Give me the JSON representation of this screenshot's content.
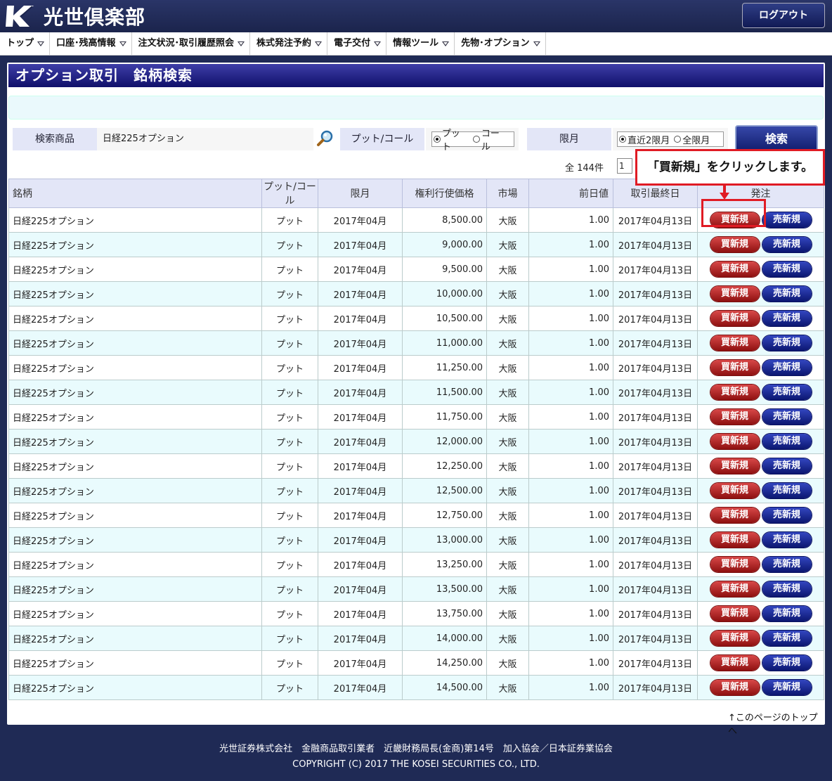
{
  "header": {
    "logo_text": "光世倶楽部",
    "logout_label": "ログアウト"
  },
  "nav": [
    {
      "label": "トップ"
    },
    {
      "label": "口座･残高情報"
    },
    {
      "label": "注文状況･取引履歴照会"
    },
    {
      "label": "株式発注予約"
    },
    {
      "label": "電子交付"
    },
    {
      "label": "情報ツール"
    },
    {
      "label": "先物･オプション"
    }
  ],
  "page_title": "オプション取引　銘柄検索",
  "search": {
    "product_label": "検索商品",
    "product_value": "日経225オプション",
    "putcall_label": "プット/コール",
    "put_option": "プット",
    "call_option": "コール",
    "putcall_selected": "プット",
    "expiry_label": "限月",
    "expiry_recent": "直近2限月",
    "expiry_all": "全限月",
    "expiry_selected": "直近2限月",
    "search_button": "検索"
  },
  "results": {
    "count_text": "全 144件",
    "page": "1"
  },
  "table": {
    "headers": [
      "銘柄",
      "プット/コール",
      "限月",
      "権利行使価格",
      "市場",
      "前日値",
      "取引最終日",
      "発注"
    ],
    "buy_label": "買新規",
    "sell_label": "売新規",
    "rows": [
      {
        "name": "日経225オプション",
        "type": "プット",
        "month": "2017年04月",
        "strike": "8,500.00",
        "market": "大阪",
        "prev": "1.00",
        "last": "2017年04月13日"
      },
      {
        "name": "日経225オプション",
        "type": "プット",
        "month": "2017年04月",
        "strike": "9,000.00",
        "market": "大阪",
        "prev": "1.00",
        "last": "2017年04月13日"
      },
      {
        "name": "日経225オプション",
        "type": "プット",
        "month": "2017年04月",
        "strike": "9,500.00",
        "market": "大阪",
        "prev": "1.00",
        "last": "2017年04月13日"
      },
      {
        "name": "日経225オプション",
        "type": "プット",
        "month": "2017年04月",
        "strike": "10,000.00",
        "market": "大阪",
        "prev": "1.00",
        "last": "2017年04月13日"
      },
      {
        "name": "日経225オプション",
        "type": "プット",
        "month": "2017年04月",
        "strike": "10,500.00",
        "market": "大阪",
        "prev": "1.00",
        "last": "2017年04月13日"
      },
      {
        "name": "日経225オプション",
        "type": "プット",
        "month": "2017年04月",
        "strike": "11,000.00",
        "market": "大阪",
        "prev": "1.00",
        "last": "2017年04月13日"
      },
      {
        "name": "日経225オプション",
        "type": "プット",
        "month": "2017年04月",
        "strike": "11,250.00",
        "market": "大阪",
        "prev": "1.00",
        "last": "2017年04月13日"
      },
      {
        "name": "日経225オプション",
        "type": "プット",
        "month": "2017年04月",
        "strike": "11,500.00",
        "market": "大阪",
        "prev": "1.00",
        "last": "2017年04月13日"
      },
      {
        "name": "日経225オプション",
        "type": "プット",
        "month": "2017年04月",
        "strike": "11,750.00",
        "market": "大阪",
        "prev": "1.00",
        "last": "2017年04月13日"
      },
      {
        "name": "日経225オプション",
        "type": "プット",
        "month": "2017年04月",
        "strike": "12,000.00",
        "market": "大阪",
        "prev": "1.00",
        "last": "2017年04月13日"
      },
      {
        "name": "日経225オプション",
        "type": "プット",
        "month": "2017年04月",
        "strike": "12,250.00",
        "market": "大阪",
        "prev": "1.00",
        "last": "2017年04月13日"
      },
      {
        "name": "日経225オプション",
        "type": "プット",
        "month": "2017年04月",
        "strike": "12,500.00",
        "market": "大阪",
        "prev": "1.00",
        "last": "2017年04月13日"
      },
      {
        "name": "日経225オプション",
        "type": "プット",
        "month": "2017年04月",
        "strike": "12,750.00",
        "market": "大阪",
        "prev": "1.00",
        "last": "2017年04月13日"
      },
      {
        "name": "日経225オプション",
        "type": "プット",
        "month": "2017年04月",
        "strike": "13,000.00",
        "market": "大阪",
        "prev": "1.00",
        "last": "2017年04月13日"
      },
      {
        "name": "日経225オプション",
        "type": "プット",
        "month": "2017年04月",
        "strike": "13,250.00",
        "market": "大阪",
        "prev": "1.00",
        "last": "2017年04月13日"
      },
      {
        "name": "日経225オプション",
        "type": "プット",
        "month": "2017年04月",
        "strike": "13,500.00",
        "market": "大阪",
        "prev": "1.00",
        "last": "2017年04月13日"
      },
      {
        "name": "日経225オプション",
        "type": "プット",
        "month": "2017年04月",
        "strike": "13,750.00",
        "market": "大阪",
        "prev": "1.00",
        "last": "2017年04月13日"
      },
      {
        "name": "日経225オプション",
        "type": "プット",
        "month": "2017年04月",
        "strike": "14,000.00",
        "market": "大阪",
        "prev": "1.00",
        "last": "2017年04月13日"
      },
      {
        "name": "日経225オプション",
        "type": "プット",
        "month": "2017年04月",
        "strike": "14,250.00",
        "market": "大阪",
        "prev": "1.00",
        "last": "2017年04月13日"
      },
      {
        "name": "日経225オプション",
        "type": "プット",
        "month": "2017年04月",
        "strike": "14,500.00",
        "market": "大阪",
        "prev": "1.00",
        "last": "2017年04月13日"
      }
    ]
  },
  "annotation": {
    "callout_text": "「買新規」をクリックします。"
  },
  "page_top_link": "↑このページのトップへ",
  "footer": {
    "line1": "光世証券株式会社　金融商品取引業者　近畿財務局長(金商)第14号　加入協会／日本証券業協会",
    "line2": "COPYRIGHT (C) 2017 THE KOSEI SECURITIES CO., LTD."
  },
  "colors": {
    "background": "#1f2a55",
    "title_bar": "#10106a",
    "buy_button": "#b01c1c",
    "sell_button": "#1a2590",
    "row_alt": "#e9fbfd",
    "annotation": "#e01b24"
  },
  "icons": [
    "logo-k-icon",
    "search-icon",
    "chevron-down-icon",
    "down-arrow-icon"
  ]
}
